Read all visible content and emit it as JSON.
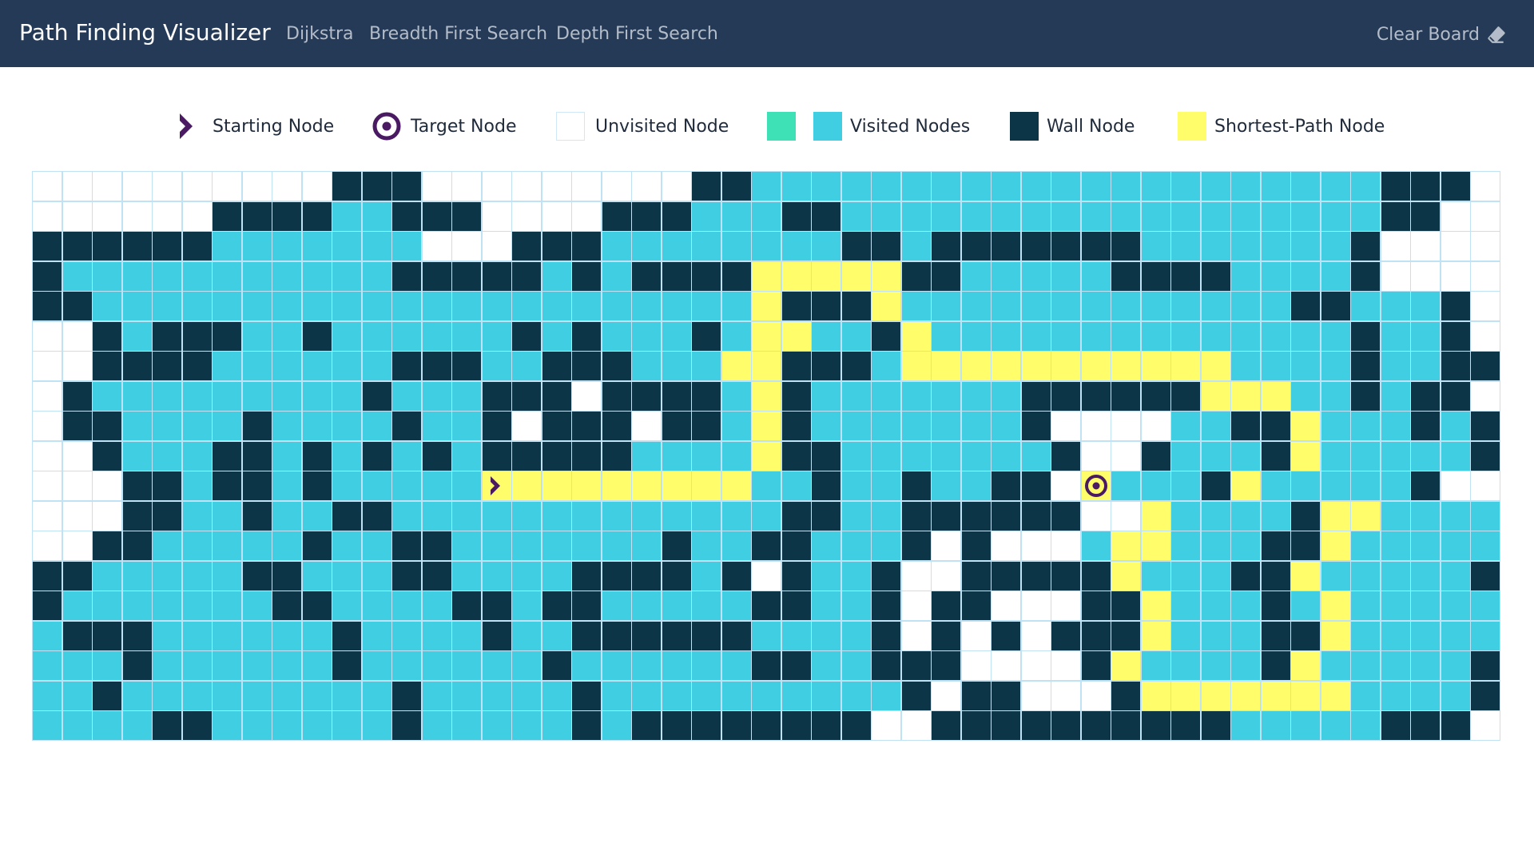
{
  "navbar": {
    "brand": "Path Finding Visualizer",
    "links": [
      "Dijkstra",
      "Breadth First Search",
      "Depth First Search"
    ],
    "clear_label": "Clear Board",
    "clear_icon": "eraser-icon"
  },
  "legend": {
    "start": "Starting Node",
    "target": "Target Node",
    "unvisited": "Unvisited Node",
    "visited": "Visited Nodes",
    "wall": "Wall Node",
    "path": "Shortest-Path Node"
  },
  "colors": {
    "navbar": "#243a57",
    "unvisited": "#ffffff",
    "visited": "#40cee3",
    "visited_alt": "#3ee0b5",
    "wall": "#0c3547",
    "path": "#fffe6a",
    "start_target_icon": "#4a1a63"
  },
  "grid": {
    "rows": [
      "UUUUUUUUUUWWWUUUUUUUUUWWVVVVVVVVVVVVVVVVVVVVVWWW",
      "UUUUUUWWWWVVWWWUUUUWWWVVVWWVVVVVVVVVVVVVVVVVVWWUU",
      "WWWWWWVVVVVVVUUUWWWVVVVVVVVWWVWWWWWWWVVVVVVVWUUU",
      "WVVVVVVVVVVVWWWWWVWVWWWWPPPPPWWVVVVVWWWWVVVVWUUU",
      "WWVVVVVVVVVVVVVVVVVVVVVVPWWWPVVVVVVVVVVVVVWWVVVWUU",
      "UUWVWWWVVWVVVVVVWVWVVVWVPPVVWPVVVVVVVVVVVVVVWVVWUW",
      "UUWWWWVVVVVVWWWVVWWWVVVPPWWWVPPPPPPPPPPPVVVVWVVWWW",
      "UWVVVVVVVVVWVVVWWWUWWWWVPWVVVVVVVWWWWWWPPPVVWVWWU",
      "UWWVVVVWVVVVWVVWUWWWUWWVPWVVVVVVVWUUUUVVWWPVVVWVWU",
      "UUWVVVWWVWVWVWVWWWWWVVVVPWWVVVVVVVWUUWVVVWPVVVVVWU",
      "UUUWWVWWVWVVVVVSPPPPPPPPVVWVVWVVWWUTVVVWPVVVVVWU",
      "UUUWWVVWVVWWVVVVVVVVVVVVVWWVVWWWWWWUUPVVVVWPPVVVVWU",
      "UUWWVVVVVWVVWWVVVVVVVWVVWWVVVWUWUUUVPPVVVWWPVVVVVW",
      "WWVVVVVWWVVVWWVVVVWWWWVWUWVVWUUWWWWWPVVVWWPVVVVVW",
      "WVVVVVVVWWVVVVWWVWWVVVVVWWVVWUWWUUUWWPVVVWVPVVVVVW",
      "VWWWVVVVVVWVVVVWVVWWWWWWVVVVWUWUWUWWWPVVVWWPVVVVVW",
      "VVVWVVVVVVWVVVVVVWVVVVVVWWVVWWWUUUUWPVVVVWPVVVVVW",
      "VVWVVVVVVVVVWVVVVVWVVVVVVVVVVWUWWUUUWPPPPPPPVVVVWW",
      "VVVVWWVVVVVVWVVVVVWVWWWWWWWWUUWWWWWWWWWWVVVVVWWWU"
    ]
  }
}
